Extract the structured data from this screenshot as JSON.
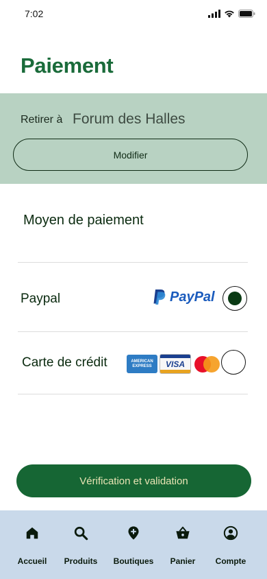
{
  "status_bar": {
    "time": "7:02",
    "icons": [
      "signal-icon",
      "wifi-icon",
      "battery-icon"
    ]
  },
  "header": {
    "title": "Paiement"
  },
  "pickup": {
    "label": "Retirer à",
    "store": "Forum des Halles",
    "modify_label": "Modifier"
  },
  "payment": {
    "section_title": "Moyen de paiement",
    "methods": [
      {
        "label": "Paypal",
        "logo_text": "PayPal",
        "selected": true
      },
      {
        "label": "Carte de crédit",
        "selected": false,
        "cards": [
          "AMERICAN EXPRESS",
          "VISA",
          "mastercard-logo"
        ]
      }
    ]
  },
  "submit_label": "Vérification et validation",
  "tabbar": {
    "items": [
      {
        "label": "Accueil",
        "icon": "home-icon"
      },
      {
        "label": "Produits",
        "icon": "search-icon"
      },
      {
        "label": "Boutiques",
        "icon": "add-location-icon"
      },
      {
        "label": "Panier",
        "icon": "basket-icon"
      },
      {
        "label": "Compte",
        "icon": "account-icon"
      }
    ]
  },
  "colors": {
    "brand_green": "#1a6b3a",
    "button_green": "#166634",
    "pickup_bg": "#b8d2c2",
    "tabbar_bg": "#c9d9ea",
    "paypal_blue": "#1a5bbd"
  }
}
